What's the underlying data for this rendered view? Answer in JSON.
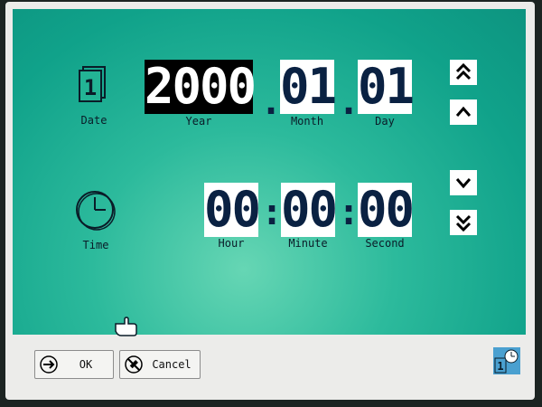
{
  "date": {
    "label": "Date",
    "icon_digit": "1",
    "year": {
      "value": "2000",
      "caption": "Year",
      "selected": true
    },
    "separator": ".",
    "month": {
      "value": "01",
      "caption": "Month"
    },
    "day": {
      "value": "01",
      "caption": "Day"
    }
  },
  "time": {
    "label": "Time",
    "separator": ":",
    "hour": {
      "value": "00",
      "caption": "Hour"
    },
    "minute": {
      "value": "00",
      "caption": "Minute"
    },
    "second": {
      "value": "00",
      "caption": "Second"
    }
  },
  "buttons": {
    "ok": "OK",
    "cancel": "Cancel"
  },
  "corner_icon_digit": "1",
  "icons": [
    "calendar-icon",
    "clock-icon",
    "double-up-icon",
    "up-icon",
    "down-icon",
    "double-down-icon",
    "arrow-right-icon",
    "cancel-icon",
    "hand-cursor-icon",
    "date-time-app-icon"
  ],
  "colors": {
    "background": "#10a28a",
    "field_text": "#0a2142",
    "selected_bg": "#000000",
    "bar": "#ececea"
  }
}
